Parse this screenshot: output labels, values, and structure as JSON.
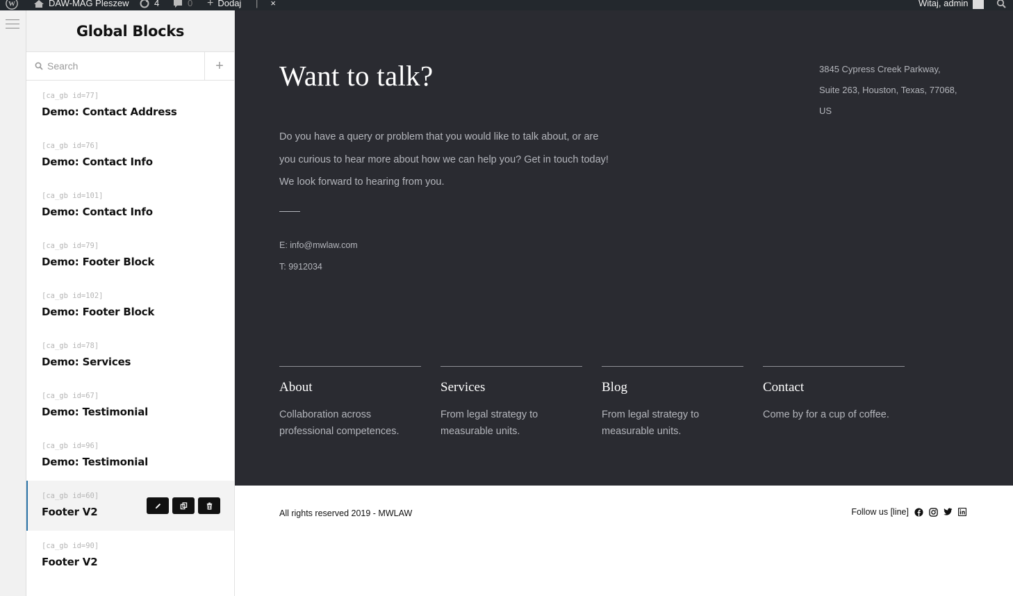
{
  "admin_bar": {
    "site_name": "DAW-MAG Pleszew",
    "updates_count": "4",
    "comments_count": "0",
    "new_label": "Dodaj",
    "greeting": "Witaj, admin"
  },
  "panel": {
    "title": "Global Blocks",
    "search_placeholder": "Search",
    "add_label": "+",
    "blocks": [
      {
        "shortcode": "[ca_gb id=77]",
        "title": "Demo: Contact Address"
      },
      {
        "shortcode": "[ca_gb id=76]",
        "title": "Demo: Contact Info"
      },
      {
        "shortcode": "[ca_gb id=101]",
        "title": "Demo: Contact Info"
      },
      {
        "shortcode": "[ca_gb id=79]",
        "title": "Demo: Footer Block"
      },
      {
        "shortcode": "[ca_gb id=102]",
        "title": "Demo: Footer Block"
      },
      {
        "shortcode": "[ca_gb id=78]",
        "title": "Demo: Services"
      },
      {
        "shortcode": "[ca_gb id=67]",
        "title": "Demo: Testimonial"
      },
      {
        "shortcode": "[ca_gb id=96]",
        "title": "Demo: Testimonial"
      },
      {
        "shortcode": "[ca_gb id=60]",
        "title": "Footer V2"
      },
      {
        "shortcode": "[ca_gb id=90]",
        "title": "Footer V2"
      }
    ]
  },
  "preview": {
    "hero_title": "Want to talk?",
    "address_line1": "3845 Cypress Creek Parkway,",
    "address_line2": "Suite 263, Houston, Texas, 77068, US",
    "intro_line1": "Do you have a query or problem that you would like to talk about, or are",
    "intro_line2": "you curious to hear more about how we can help you? Get in touch today!",
    "intro_line3": "We look forward to hearing from you.",
    "email": "E: info@mwlaw.com",
    "phone": "T: 9912034",
    "columns": [
      {
        "title": "About",
        "text": "Collaboration across professional competences."
      },
      {
        "title": "Services",
        "text": "From legal strategy to measurable units."
      },
      {
        "title": "Blog",
        "text": "From legal strategy to measurable units."
      },
      {
        "title": "Contact",
        "text": "Come by for a cup of coffee."
      }
    ],
    "copyright": "All rights reserved 2019 - MWLAW",
    "follow_label": "Follow us [line]"
  },
  "colors": {
    "dark_bg": "#2a2b31",
    "admin_bar_bg": "#23282d",
    "active_accent": "#2a73a8"
  }
}
